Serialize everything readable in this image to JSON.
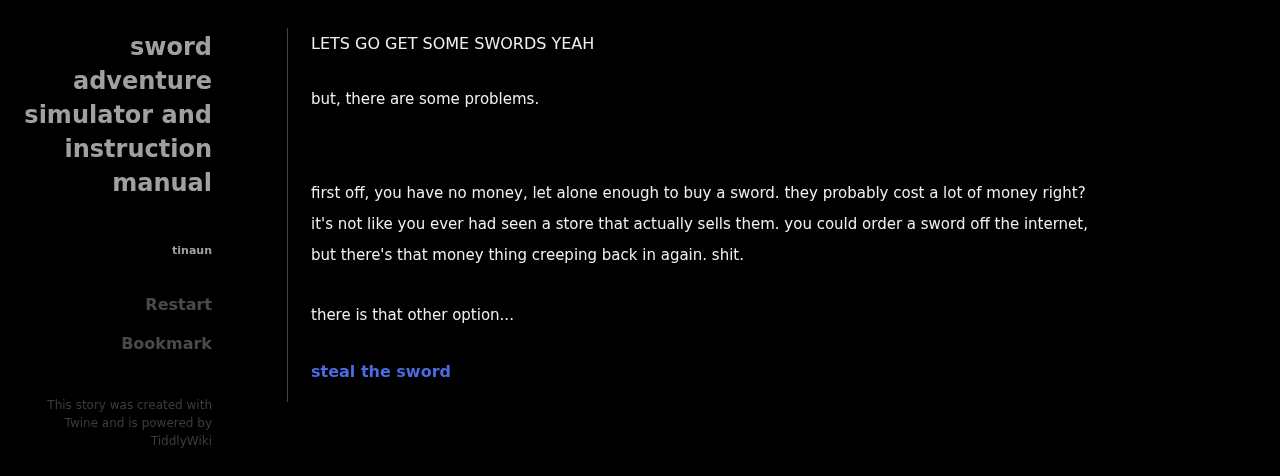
{
  "sidebar": {
    "title": "sword adventure simulator and instruction manual",
    "author": "tinaun",
    "menu": [
      {
        "label": "Restart"
      },
      {
        "label": "Bookmark"
      }
    ],
    "credits": "This story was created with Twine and is powered by TiddlyWiki"
  },
  "passage": {
    "heading": "LETS GO GET SOME SWORDS YEAH",
    "paragraphs": [
      {
        "lines": [
          "but, there are some problems."
        ]
      },
      {
        "lines": [
          "first off, you have no money, let alone enough to buy a sword. they probably cost a lot of money right?",
          "it's not like you ever had seen a store that actually sells them. you could order a sword off the internet,",
          "but there's that money thing creeping back in again. shit."
        ]
      },
      {
        "lines": [
          "there is that other option..."
        ]
      }
    ],
    "link": "steal the sword"
  }
}
